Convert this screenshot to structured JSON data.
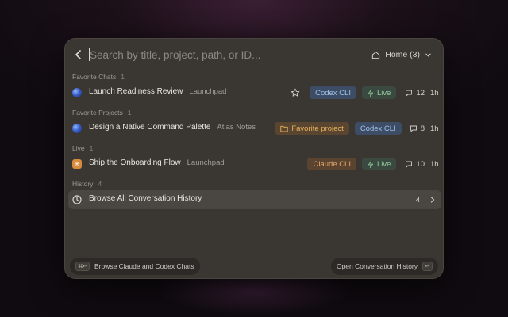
{
  "search": {
    "placeholder": "Search by title, project, path, or ID...",
    "value": ""
  },
  "scope": {
    "label": "Home (3)"
  },
  "sections": {
    "favorite_chats": {
      "label": "Favorite Chats",
      "count": "1"
    },
    "favorite_projects": {
      "label": "Favorite Projects",
      "count": "1"
    },
    "live": {
      "label": "Live",
      "count": "1"
    },
    "history": {
      "label": "History",
      "count": "4"
    }
  },
  "rows": {
    "launch": {
      "title": "Launch Readiness Review",
      "project": "Launchpad",
      "badge_codex": "Codex CLI",
      "badge_live": "Live",
      "comments": "12",
      "time": "1h"
    },
    "palette": {
      "title": "Design a Native Command Palette",
      "project": "Atlas Notes",
      "badge_fav": "Favorite project",
      "badge_codex": "Codex CLI",
      "comments": "8",
      "time": "1h"
    },
    "onboarding": {
      "title": "Ship the Onboarding Flow",
      "project": "Launchpad",
      "badge_claude": "Claude CLI",
      "badge_live": "Live",
      "comments": "10",
      "time": "1h"
    },
    "history": {
      "title": "Browse All Conversation History",
      "count": "4"
    }
  },
  "footer": {
    "left_label": "Browse Claude and Codex Chats",
    "left_kbd": "⌘↵",
    "right_label": "Open Conversation History",
    "right_kbd": "↵"
  },
  "colors": {
    "codex": "#9fc1ea",
    "live": "#93c79f",
    "claude": "#e5a86e",
    "favorite": "#e8b25e"
  }
}
